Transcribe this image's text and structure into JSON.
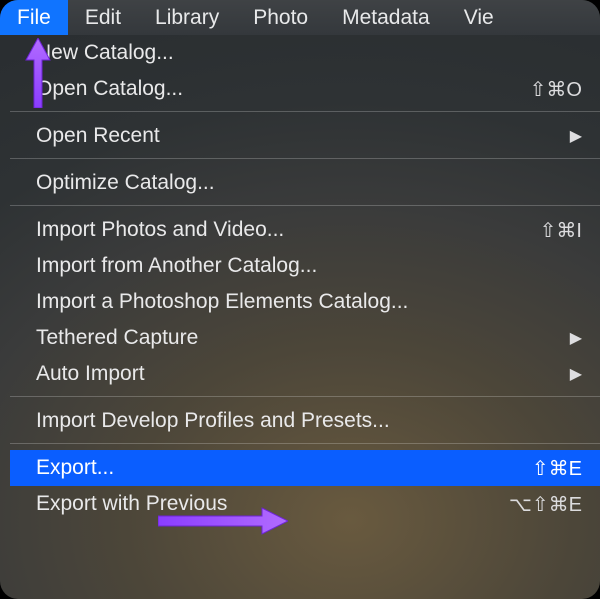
{
  "menubar": {
    "items": [
      {
        "label": "File",
        "active": true
      },
      {
        "label": "Edit",
        "active": false
      },
      {
        "label": "Library",
        "active": false
      },
      {
        "label": "Photo",
        "active": false
      },
      {
        "label": "Metadata",
        "active": false
      },
      {
        "label": "Vie",
        "active": false
      }
    ]
  },
  "menu": {
    "items": [
      {
        "label": "New Catalog...",
        "shortcut": "",
        "submenu": false,
        "highlight": false
      },
      {
        "label": "Open Catalog...",
        "shortcut": "⇧⌘O",
        "submenu": false,
        "highlight": false
      },
      {
        "separator": true
      },
      {
        "label": "Open Recent",
        "shortcut": "",
        "submenu": true,
        "highlight": false
      },
      {
        "separator": true
      },
      {
        "label": "Optimize Catalog...",
        "shortcut": "",
        "submenu": false,
        "highlight": false
      },
      {
        "separator": true
      },
      {
        "label": "Import Photos and Video...",
        "shortcut": "⇧⌘I",
        "submenu": false,
        "highlight": false
      },
      {
        "label": "Import from Another Catalog...",
        "shortcut": "",
        "submenu": false,
        "highlight": false
      },
      {
        "label": "Import a Photoshop Elements Catalog...",
        "shortcut": "",
        "submenu": false,
        "highlight": false
      },
      {
        "label": "Tethered Capture",
        "shortcut": "",
        "submenu": true,
        "highlight": false
      },
      {
        "label": "Auto Import",
        "shortcut": "",
        "submenu": true,
        "highlight": false
      },
      {
        "separator": true
      },
      {
        "label": "Import Develop Profiles and Presets...",
        "shortcut": "",
        "submenu": false,
        "highlight": false
      },
      {
        "separator": true
      },
      {
        "label": "Export...",
        "shortcut": "⇧⌘E",
        "submenu": false,
        "highlight": true
      },
      {
        "label": "Export with Previous",
        "shortcut": "⌥⇧⌘E",
        "submenu": false,
        "highlight": false
      }
    ]
  },
  "annotations": {
    "arrow_up_target": "menubar-item-file",
    "arrow_right_target": "menu-item-export"
  },
  "colors": {
    "highlight": "#0a5eff",
    "menubar_active": "#1074ff",
    "arrow": "#a24dff"
  }
}
